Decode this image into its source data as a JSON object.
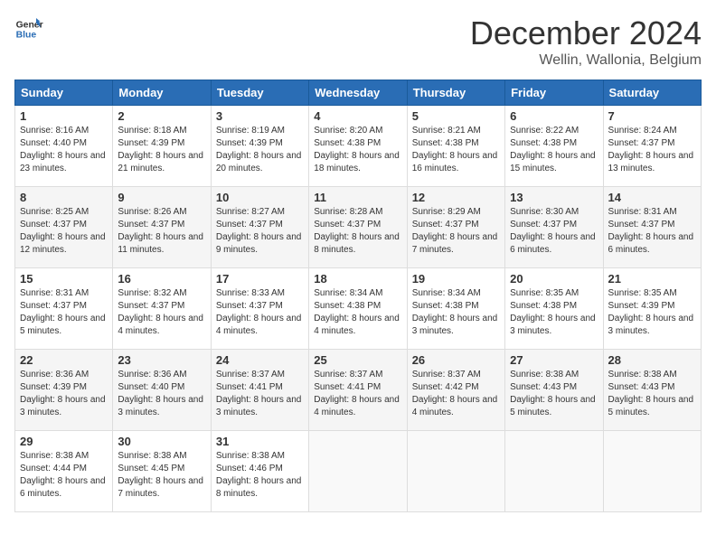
{
  "logo": {
    "line1": "General",
    "line2": "Blue"
  },
  "title": "December 2024",
  "location": "Wellin, Wallonia, Belgium",
  "days_of_week": [
    "Sunday",
    "Monday",
    "Tuesday",
    "Wednesday",
    "Thursday",
    "Friday",
    "Saturday"
  ],
  "weeks": [
    [
      {
        "day": "1",
        "sunrise": "8:16 AM",
        "sunset": "4:40 PM",
        "daylight": "8 hours and 23 minutes."
      },
      {
        "day": "2",
        "sunrise": "8:18 AM",
        "sunset": "4:39 PM",
        "daylight": "8 hours and 21 minutes."
      },
      {
        "day": "3",
        "sunrise": "8:19 AM",
        "sunset": "4:39 PM",
        "daylight": "8 hours and 20 minutes."
      },
      {
        "day": "4",
        "sunrise": "8:20 AM",
        "sunset": "4:38 PM",
        "daylight": "8 hours and 18 minutes."
      },
      {
        "day": "5",
        "sunrise": "8:21 AM",
        "sunset": "4:38 PM",
        "daylight": "8 hours and 16 minutes."
      },
      {
        "day": "6",
        "sunrise": "8:22 AM",
        "sunset": "4:38 PM",
        "daylight": "8 hours and 15 minutes."
      },
      {
        "day": "7",
        "sunrise": "8:24 AM",
        "sunset": "4:37 PM",
        "daylight": "8 hours and 13 minutes."
      }
    ],
    [
      {
        "day": "8",
        "sunrise": "8:25 AM",
        "sunset": "4:37 PM",
        "daylight": "8 hours and 12 minutes."
      },
      {
        "day": "9",
        "sunrise": "8:26 AM",
        "sunset": "4:37 PM",
        "daylight": "8 hours and 11 minutes."
      },
      {
        "day": "10",
        "sunrise": "8:27 AM",
        "sunset": "4:37 PM",
        "daylight": "8 hours and 9 minutes."
      },
      {
        "day": "11",
        "sunrise": "8:28 AM",
        "sunset": "4:37 PM",
        "daylight": "8 hours and 8 minutes."
      },
      {
        "day": "12",
        "sunrise": "8:29 AM",
        "sunset": "4:37 PM",
        "daylight": "8 hours and 7 minutes."
      },
      {
        "day": "13",
        "sunrise": "8:30 AM",
        "sunset": "4:37 PM",
        "daylight": "8 hours and 6 minutes."
      },
      {
        "day": "14",
        "sunrise": "8:31 AM",
        "sunset": "4:37 PM",
        "daylight": "8 hours and 6 minutes."
      }
    ],
    [
      {
        "day": "15",
        "sunrise": "8:31 AM",
        "sunset": "4:37 PM",
        "daylight": "8 hours and 5 minutes."
      },
      {
        "day": "16",
        "sunrise": "8:32 AM",
        "sunset": "4:37 PM",
        "daylight": "8 hours and 4 minutes."
      },
      {
        "day": "17",
        "sunrise": "8:33 AM",
        "sunset": "4:37 PM",
        "daylight": "8 hours and 4 minutes."
      },
      {
        "day": "18",
        "sunrise": "8:34 AM",
        "sunset": "4:38 PM",
        "daylight": "8 hours and 4 minutes."
      },
      {
        "day": "19",
        "sunrise": "8:34 AM",
        "sunset": "4:38 PM",
        "daylight": "8 hours and 3 minutes."
      },
      {
        "day": "20",
        "sunrise": "8:35 AM",
        "sunset": "4:38 PM",
        "daylight": "8 hours and 3 minutes."
      },
      {
        "day": "21",
        "sunrise": "8:35 AM",
        "sunset": "4:39 PM",
        "daylight": "8 hours and 3 minutes."
      }
    ],
    [
      {
        "day": "22",
        "sunrise": "8:36 AM",
        "sunset": "4:39 PM",
        "daylight": "8 hours and 3 minutes."
      },
      {
        "day": "23",
        "sunrise": "8:36 AM",
        "sunset": "4:40 PM",
        "daylight": "8 hours and 3 minutes."
      },
      {
        "day": "24",
        "sunrise": "8:37 AM",
        "sunset": "4:41 PM",
        "daylight": "8 hours and 3 minutes."
      },
      {
        "day": "25",
        "sunrise": "8:37 AM",
        "sunset": "4:41 PM",
        "daylight": "8 hours and 4 minutes."
      },
      {
        "day": "26",
        "sunrise": "8:37 AM",
        "sunset": "4:42 PM",
        "daylight": "8 hours and 4 minutes."
      },
      {
        "day": "27",
        "sunrise": "8:38 AM",
        "sunset": "4:43 PM",
        "daylight": "8 hours and 5 minutes."
      },
      {
        "day": "28",
        "sunrise": "8:38 AM",
        "sunset": "4:43 PM",
        "daylight": "8 hours and 5 minutes."
      }
    ],
    [
      {
        "day": "29",
        "sunrise": "8:38 AM",
        "sunset": "4:44 PM",
        "daylight": "8 hours and 6 minutes."
      },
      {
        "day": "30",
        "sunrise": "8:38 AM",
        "sunset": "4:45 PM",
        "daylight": "8 hours and 7 minutes."
      },
      {
        "day": "31",
        "sunrise": "8:38 AM",
        "sunset": "4:46 PM",
        "daylight": "8 hours and 8 minutes."
      },
      null,
      null,
      null,
      null
    ]
  ]
}
